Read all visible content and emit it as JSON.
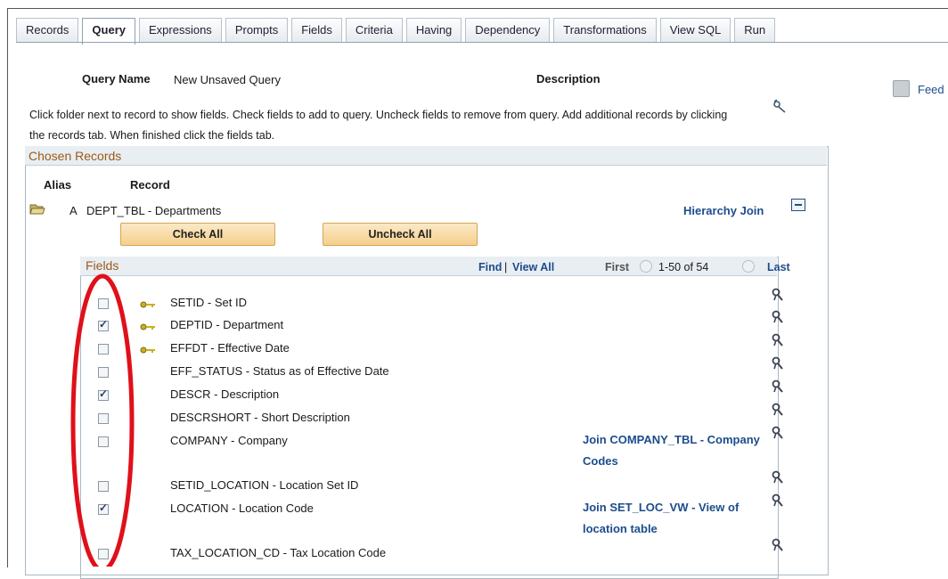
{
  "tabs": [
    "Records",
    "Query",
    "Expressions",
    "Prompts",
    "Fields",
    "Criteria",
    "Having",
    "Dependency",
    "Transformations",
    "View SQL",
    "Run"
  ],
  "active_tab": "Query",
  "header": {
    "query_name_label": "Query Name",
    "query_name_value": "New Unsaved Query",
    "description_label": "Description",
    "feed_label": "Feed"
  },
  "instructions": "Click folder next to record to show fields. Check fields to add to query. Uncheck fields to remove from query. Add additional records by clicking the records tab. When finished click the fields tab.",
  "chosen_records": {
    "title": "Chosen Records",
    "alias_header": "Alias",
    "record_header": "Record",
    "alias": "A",
    "record": "DEPT_TBL - Departments",
    "hierarchy_join": "Hierarchy Join",
    "check_all": "Check All",
    "uncheck_all": "Uncheck All"
  },
  "fields_grid": {
    "title": "Fields",
    "find": "Find",
    "view_all": "View All",
    "separator": "|",
    "first": "First",
    "range": "1-50 of 54",
    "last": "Last",
    "rows": [
      {
        "name": "SETID - Set ID",
        "checked": false,
        "key": true,
        "join": ""
      },
      {
        "name": "DEPTID - Department",
        "checked": true,
        "key": true,
        "join": ""
      },
      {
        "name": "EFFDT - Effective Date",
        "checked": false,
        "key": true,
        "join": ""
      },
      {
        "name": "EFF_STATUS - Status as of Effective Date",
        "checked": false,
        "key": false,
        "join": ""
      },
      {
        "name": "DESCR - Description",
        "checked": true,
        "key": false,
        "join": ""
      },
      {
        "name": "DESCRSHORT - Short Description",
        "checked": false,
        "key": false,
        "join": ""
      },
      {
        "name": "COMPANY - Company",
        "checked": false,
        "key": false,
        "join": "Join COMPANY_TBL - Company Codes"
      },
      {
        "name": "SETID_LOCATION - Location Set ID",
        "checked": false,
        "key": false,
        "join": ""
      },
      {
        "name": "LOCATION - Location Code",
        "checked": true,
        "key": false,
        "join": "Join SET_LOC_VW - View of location table"
      },
      {
        "name": "TAX_LOCATION_CD - Tax Location Code",
        "checked": false,
        "key": false,
        "join": ""
      }
    ]
  },
  "colors": {
    "link": "#1d4c8c",
    "section_title": "#9b5a18",
    "annotation": "#e0101a"
  }
}
